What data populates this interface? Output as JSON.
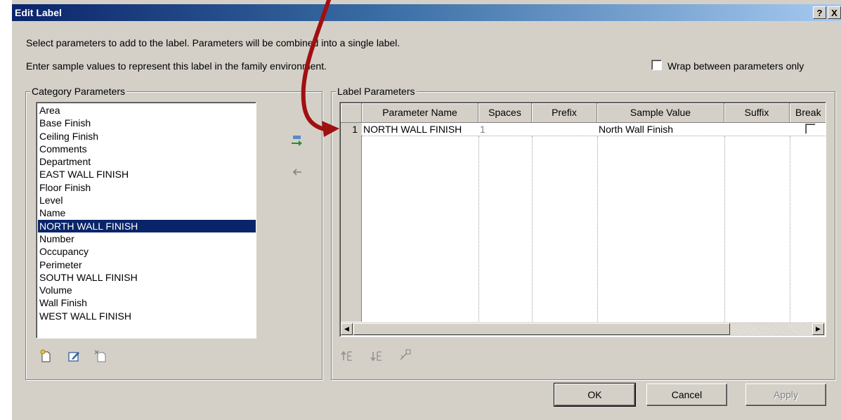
{
  "window": {
    "title": "Edit Label",
    "help_label": "?",
    "close_label": "X"
  },
  "instructions": {
    "line1": "Select parameters to add to the label.  Parameters will be combined into a single label.",
    "line2": "Enter sample values to represent this label in the family environment."
  },
  "wrap_option": {
    "label": "Wrap between parameters only",
    "checked": false
  },
  "category_parameters": {
    "title": "Category Parameters",
    "items": [
      "Area",
      "Base Finish",
      "Ceiling Finish",
      "Comments",
      "Department",
      "EAST WALL FINISH",
      "Floor Finish",
      "Level",
      "Name",
      "NORTH WALL FINISH",
      "Number",
      "Occupancy",
      "Perimeter",
      "SOUTH WALL FINISH",
      "Volume",
      "Wall Finish",
      "WEST WALL FINISH"
    ],
    "selected_index": 9,
    "tool_icons": [
      "new-parameter-icon",
      "edit-parameter-icon",
      "delete-parameter-icon"
    ]
  },
  "transfer": {
    "add_icon": "add-to-label-arrow-icon",
    "remove_icon": "remove-from-label-arrow-icon"
  },
  "label_parameters": {
    "title": "Label Parameters",
    "columns": [
      "Parameter Name",
      "Spaces",
      "Prefix",
      "Sample Value",
      "Suffix",
      "Break"
    ],
    "rows": [
      {
        "index": "1",
        "parameter_name": "NORTH WALL FINISH",
        "spaces": "1",
        "prefix": "",
        "sample_value": "North Wall Finish",
        "suffix": "",
        "break": false
      }
    ],
    "tool_icons": [
      "move-up-icon",
      "move-down-icon",
      "edit-format-icon"
    ]
  },
  "buttons": {
    "ok": "OK",
    "cancel": "Cancel",
    "apply": "Apply"
  },
  "annotation_arrow_color": "#a01010"
}
